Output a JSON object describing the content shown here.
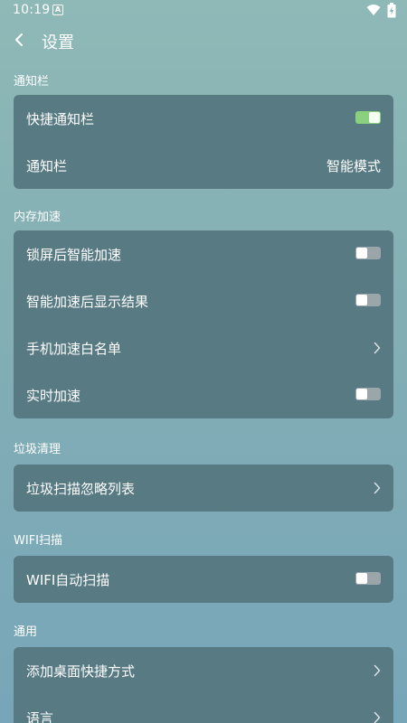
{
  "status": {
    "time": "10:19",
    "a_icon": "A"
  },
  "header": {
    "title": "设置"
  },
  "sections": {
    "notify": {
      "title": "通知栏",
      "rows": [
        {
          "label": "快捷通知栏",
          "toggle": "on"
        },
        {
          "label": "通知栏",
          "value": "智能模式"
        }
      ]
    },
    "memory": {
      "title": "内存加速",
      "rows": [
        {
          "label": "锁屏后智能加速",
          "toggle": "off"
        },
        {
          "label": "智能加速后显示结果",
          "toggle": "off"
        },
        {
          "label": "手机加速白名单"
        },
        {
          "label": "实时加速",
          "toggle": "off"
        }
      ]
    },
    "junk": {
      "title": "垃圾清理",
      "rows": [
        {
          "label": "垃圾扫描忽略列表"
        }
      ]
    },
    "wifi": {
      "title": "WIFI扫描",
      "rows": [
        {
          "label": "WIFI自动扫描",
          "toggle": "off"
        }
      ]
    },
    "general": {
      "title": "通用",
      "rows": [
        {
          "label": "添加桌面快捷方式"
        },
        {
          "label": "语言"
        }
      ]
    }
  },
  "colors": {
    "card": "#577a83",
    "toggle_on": "#8ad07f",
    "toggle_off": "#9aa6aa"
  },
  "icons": {
    "back": "chevron-left-icon",
    "chevron": "chevron-right-icon",
    "wifi": "wifi-icon",
    "battery": "battery-icon"
  }
}
